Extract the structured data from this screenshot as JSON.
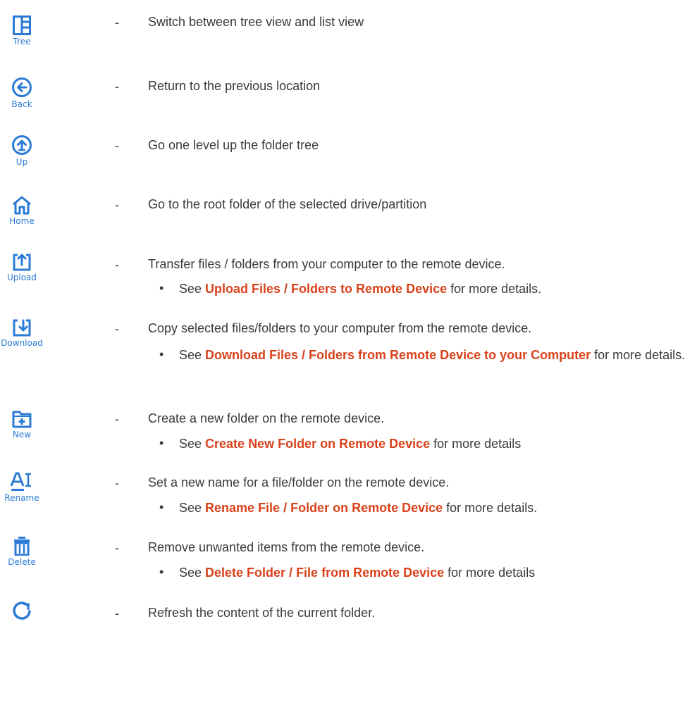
{
  "colors": {
    "icon": "#2b7bd6",
    "link": "#d9421b",
    "text": "#3a3a3a"
  },
  "items": [
    {
      "icon": "tree-view-icon",
      "label": "Tree",
      "dash": "-",
      "desc": "Switch between tree view and list view"
    },
    {
      "icon": "back-arrow-icon",
      "label": "Back",
      "dash": "-",
      "desc": "Return to the previous location"
    },
    {
      "icon": "up-arrow-icon",
      "label": "Up",
      "dash": "-",
      "desc": "Go one level up the folder tree"
    },
    {
      "icon": "home-icon",
      "label": "Home",
      "dash": "-",
      "desc": "Go to the root folder of the selected drive/partition"
    },
    {
      "icon": "upload-icon",
      "label": "Upload",
      "dash": "-",
      "desc": "Transfer files / folders from your computer to the remote device.",
      "see": {
        "bullet": "•",
        "prefix": "See ",
        "link": "Upload Files / Folders to Remote Device",
        "suffix": " for more details."
      }
    },
    {
      "icon": "download-icon",
      "label": "Download",
      "dash": "-",
      "desc": "Copy selected files/folders to your computer from the remote device.",
      "see": {
        "bullet": "•",
        "prefix": "See ",
        "link": "Download Files / Folders from Remote Device to your Computer",
        "suffix": " for more details."
      }
    },
    {
      "icon": "new-folder-icon",
      "label": "New",
      "dash": "-",
      "desc": "Create a new folder on the remote device.",
      "see": {
        "bullet": "•",
        "prefix": "See ",
        "link": "Create New Folder on Remote Device",
        "suffix": " for more details"
      }
    },
    {
      "icon": "rename-icon",
      "label": "Rename",
      "dash": "-",
      "desc": "Set a new name for a file/folder on the remote device.",
      "see": {
        "bullet": "•",
        "prefix": "See ",
        "link": "Rename File / Folder on Remote Device",
        "suffix": " for more details."
      }
    },
    {
      "icon": "delete-icon",
      "label": "Delete",
      "dash": "-",
      "desc": "Remove unwanted items from the remote device.",
      "see": {
        "bullet": "•",
        "prefix": "See ",
        "link": "Delete Folder / File from Remote Device",
        "suffix": " for more details"
      }
    },
    {
      "icon": "refresh-icon",
      "label": "",
      "dash": "-",
      "desc": "Refresh the content of the current folder."
    }
  ]
}
